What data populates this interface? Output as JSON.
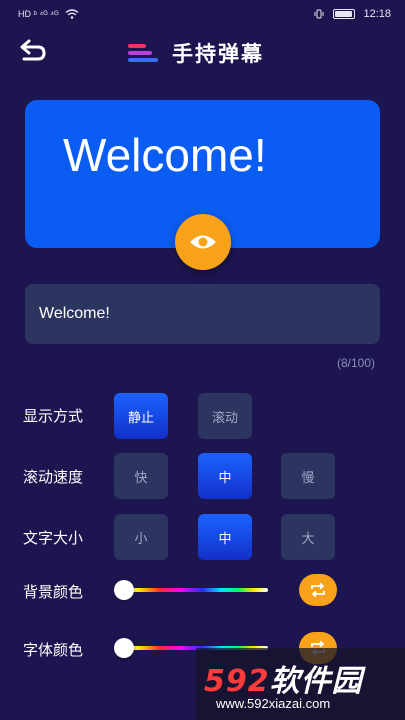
{
  "status_bar": {
    "left_indicators": "HD ᵇ ⁴ᴳ ⁴ᴳ",
    "time": "12:18"
  },
  "header": {
    "back_icon": "back-arrow-icon",
    "title": "手持弹幕",
    "logo_colors": [
      "#e8365d",
      "#b63fd6",
      "#3a6cf7"
    ]
  },
  "preview": {
    "text": "Welcome!",
    "background": "#0a5cf3",
    "eye_icon": "eye-icon",
    "eye_button_color": "#f7a21a"
  },
  "input": {
    "value": "Welcome!",
    "count": "(8/100)"
  },
  "display_mode": {
    "label": "显示方式",
    "options": [
      "静止",
      "滚动"
    ],
    "selected": "静止"
  },
  "scroll_speed": {
    "label": "滚动速度",
    "options": [
      "快",
      "中",
      "慢"
    ],
    "selected": "中"
  },
  "text_size": {
    "label": "文字大小",
    "options": [
      "小",
      "中",
      "大"
    ],
    "selected": "中"
  },
  "background_color": {
    "label": "背景颜色",
    "slider_value": 0,
    "cycle_icon": "repeat-icon"
  },
  "font_color": {
    "label": "字体颜色",
    "slider_value": 0,
    "cycle_icon": "repeat-icon"
  },
  "watermark": {
    "number": "592",
    "brand": "软件园",
    "url": "www.592xiazai.com"
  },
  "colors": {
    "background": "#1d1550",
    "accent_orange": "#f7a21a",
    "option_bg": "#2c3460",
    "option_active": "#1b63ff"
  }
}
